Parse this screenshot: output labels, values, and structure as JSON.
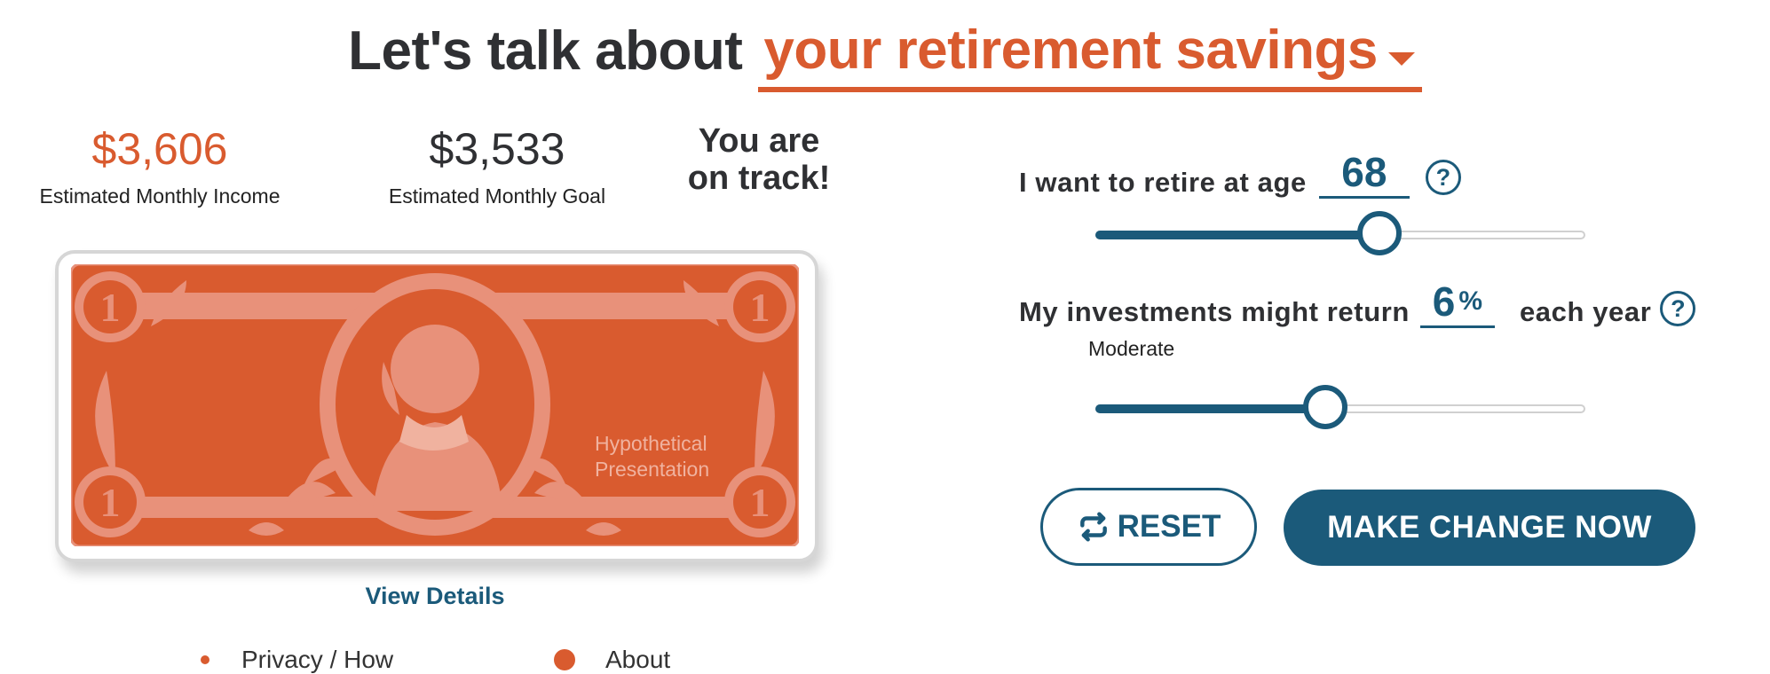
{
  "header": {
    "prefix": "Let's talk about",
    "topic": "your retirement savings"
  },
  "stats": {
    "income_value": "$3,606",
    "income_label": "Estimated Monthly Income",
    "goal_value": "$3,533",
    "goal_label": "Estimated Monthly Goal",
    "status_line1": "You are",
    "status_line2": "on track!"
  },
  "bill": {
    "denomination": "1",
    "caption_line1": "Hypothetical",
    "caption_line2": "Presentation"
  },
  "view_details_label": "View Details",
  "footer": {
    "privacy_label": "Privacy / How",
    "about_label": "About"
  },
  "retire_age": {
    "label": "I want to retire at age",
    "value": "68",
    "help": "?",
    "slider_fraction": 0.58
  },
  "investment_return": {
    "label": "My investments might return",
    "value": "6",
    "unit": "%",
    "suffix": "each year",
    "help": "?",
    "risk_label": "Moderate",
    "slider_fraction": 0.47
  },
  "actions": {
    "reset_label": "RESET",
    "make_change_label": "MAKE CHANGE NOW"
  },
  "colors": {
    "accent": "#d95b2f",
    "primary": "#1b5a7a",
    "bill_light": "#e8917a"
  },
  "icons": {
    "dropdown": "chevron-down-icon",
    "help": "help-circle-icon",
    "reset": "refresh-icon"
  }
}
